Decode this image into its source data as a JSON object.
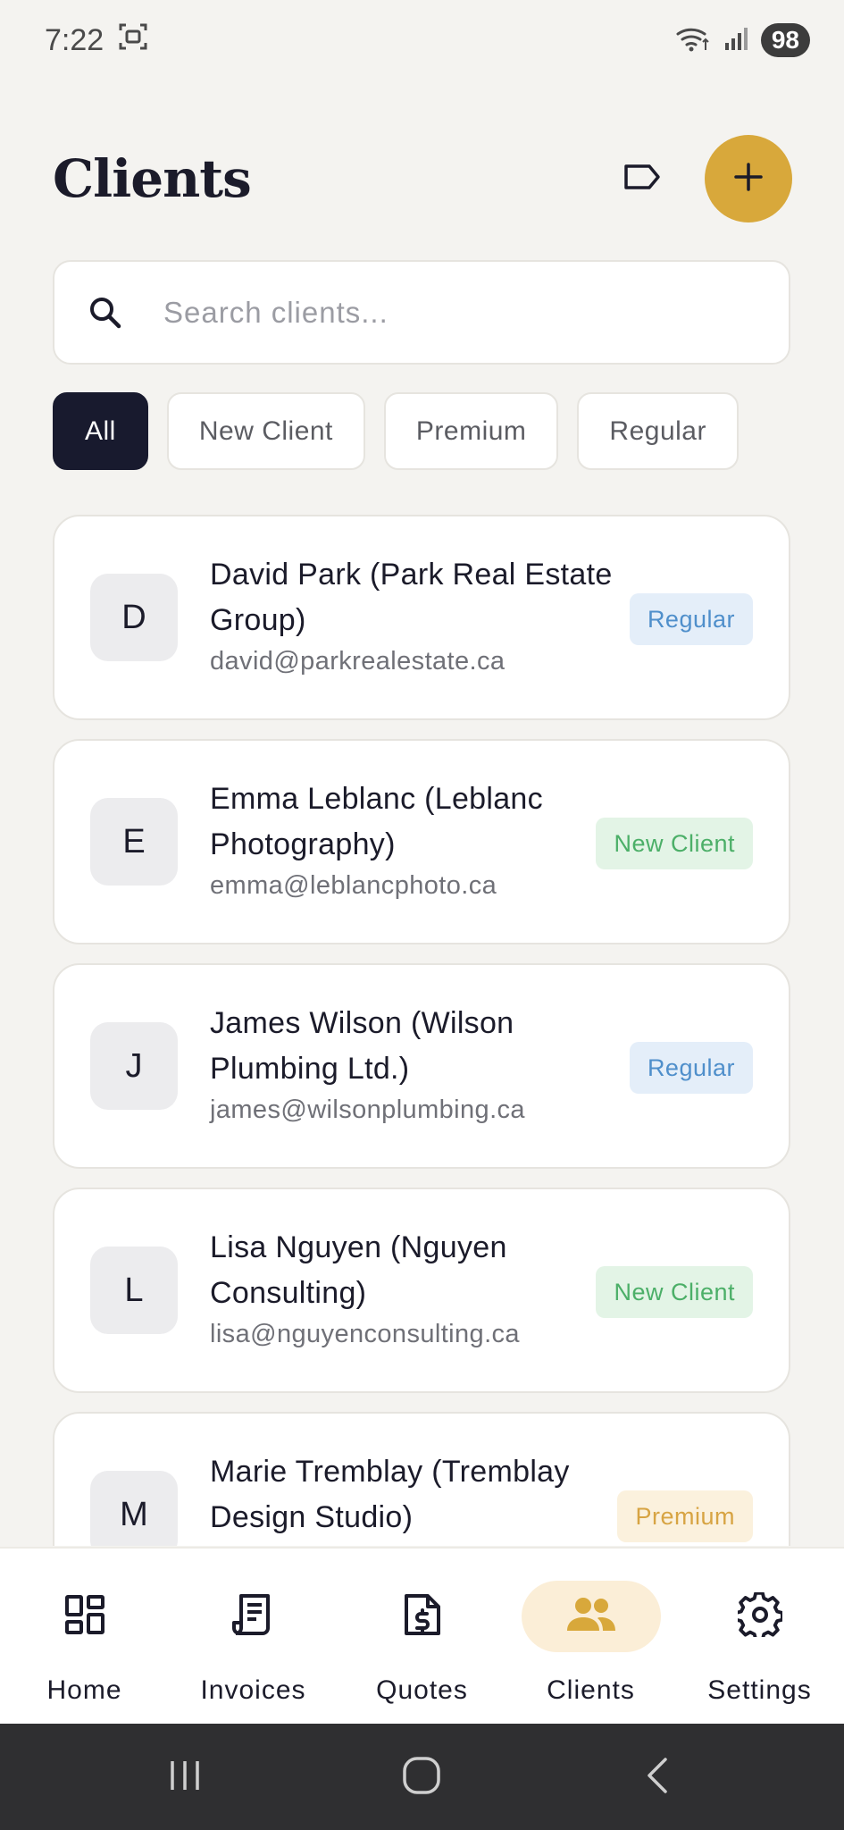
{
  "status_bar": {
    "time": "7:22",
    "battery": "98"
  },
  "header": {
    "title": "Clients"
  },
  "search": {
    "placeholder": "Search clients..."
  },
  "filters": [
    {
      "label": "All",
      "active": true
    },
    {
      "label": "New Client",
      "active": false
    },
    {
      "label": "Premium",
      "active": false
    },
    {
      "label": "Regular",
      "active": false
    }
  ],
  "clients": [
    {
      "initial": "D",
      "name": "David Park (Park Real Estate Group)",
      "email": "david@parkrealestate.ca",
      "badge": "Regular"
    },
    {
      "initial": "E",
      "name": "Emma Leblanc (Leblanc Photography)",
      "email": "emma@leblancphoto.ca",
      "badge": "New Client"
    },
    {
      "initial": "J",
      "name": "James Wilson (Wilson Plumbing Ltd.)",
      "email": "james@wilsonplumbing.ca",
      "badge": "Regular"
    },
    {
      "initial": "L",
      "name": "Lisa Nguyen (Nguyen Consulting)",
      "email": "lisa@nguyenconsulting.ca",
      "badge": "New Client"
    },
    {
      "initial": "M",
      "name": "Marie Tremblay (Tremblay Design Studio)",
      "email": "",
      "badge": "Premium"
    }
  ],
  "nav": [
    {
      "label": "Home",
      "icon": "home-dashboard-icon",
      "active": false
    },
    {
      "label": "Invoices",
      "icon": "invoice-icon",
      "active": false
    },
    {
      "label": "Quotes",
      "icon": "quote-document-icon",
      "active": false
    },
    {
      "label": "Clients",
      "icon": "people-icon",
      "active": true
    },
    {
      "label": "Settings",
      "icon": "gear-icon",
      "active": false
    }
  ],
  "colors": {
    "accent": "#D8A83B",
    "background": "#F4F3F0",
    "active_chip": "#181A2E",
    "badge_regular": "#4F8FCB",
    "badge_new": "#4CAF68",
    "badge_premium": "#D7A443"
  }
}
